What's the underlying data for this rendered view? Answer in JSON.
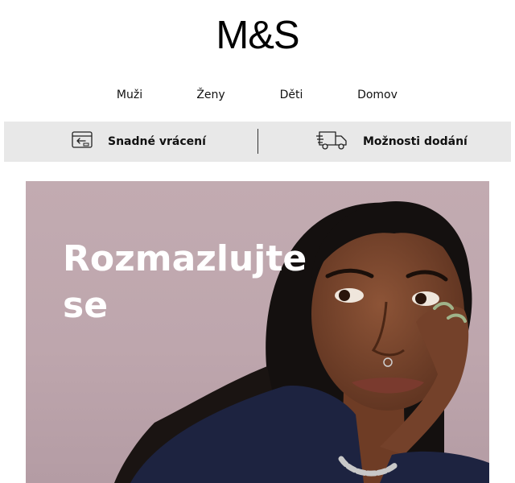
{
  "brand": {
    "logo_text": "M&S"
  },
  "nav": {
    "items": [
      {
        "label": "Muži"
      },
      {
        "label": "Ženy"
      },
      {
        "label": "Děti"
      },
      {
        "label": "Domov"
      }
    ]
  },
  "benefits": {
    "returns": {
      "label": "Snadné vrácení",
      "icon": "returns-card-icon"
    },
    "delivery": {
      "label": "Možnosti dodání",
      "icon": "delivery-truck-icon"
    }
  },
  "hero": {
    "headline": "Rozmazlujte se",
    "background_color": "#c0a9af"
  }
}
